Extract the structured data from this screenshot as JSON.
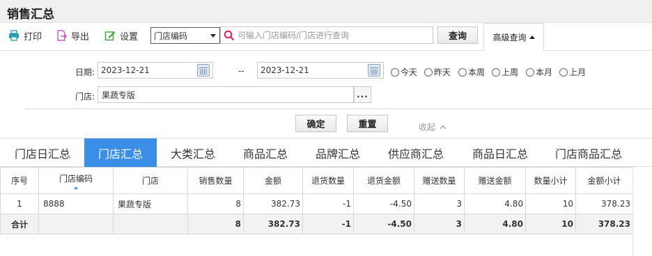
{
  "page": {
    "title": "销售汇总"
  },
  "toolbar": {
    "print": "打印",
    "export": "导出",
    "settings": "设置"
  },
  "search": {
    "field_select": "门店编码",
    "placeholder": "可输入门店编码/门店进行查询",
    "query_button": "查询",
    "advanced_tab": "高级查询"
  },
  "advanced": {
    "date_label": "日期:",
    "date_from": "2023-12-21",
    "date_sep": "--",
    "date_to": "2023-12-21",
    "quick_ranges": [
      "今天",
      "昨天",
      "本周",
      "上周",
      "本月",
      "上月"
    ],
    "store_label": "门店:",
    "store_value": "果蔬专版",
    "store_picker": "...",
    "confirm_button": "确定",
    "reset_button": "重置",
    "collapse": "收起"
  },
  "tabs": [
    {
      "label": "门店日汇总",
      "active": false
    },
    {
      "label": "门店汇总",
      "active": true
    },
    {
      "label": "大类汇总",
      "active": false
    },
    {
      "label": "商品汇总",
      "active": false
    },
    {
      "label": "品牌汇总",
      "active": false
    },
    {
      "label": "供应商汇总",
      "active": false
    },
    {
      "label": "商品日汇总",
      "active": false
    },
    {
      "label": "门店商品汇总",
      "active": false
    }
  ],
  "table": {
    "columns": [
      "序号",
      "门店编码",
      "门店",
      "销售数量",
      "金额",
      "退货数量",
      "退货金额",
      "赠送数量",
      "赠送金额",
      "数量小计",
      "金额小计"
    ],
    "sorted_column": "门店编码",
    "rows": [
      [
        "1",
        "8888",
        "果蔬专版",
        "8",
        "382.73",
        "-1",
        "-4.50",
        "3",
        "4.80",
        "10",
        "378.23"
      ]
    ],
    "summary": [
      "合计",
      "",
      "",
      "8",
      "382.73",
      "-1",
      "-4.50",
      "3",
      "4.80",
      "10",
      "378.23"
    ]
  },
  "colors": {
    "accent": "#3a8ee6",
    "search_icon": "#d6206b"
  },
  "icons": {
    "print": "printer-icon",
    "export": "export-icon",
    "settings": "settings-edit-icon",
    "search": "search-icon",
    "calendar": "calendar-icon"
  }
}
